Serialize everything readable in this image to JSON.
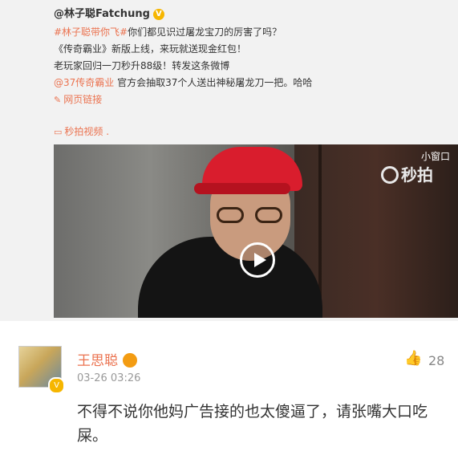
{
  "post": {
    "author": "@林子聪Fatchung",
    "verified_icon": "verified-badge-icon",
    "line1_tag": "#林子聪带你飞#",
    "line1_text": "你们都见识过屠龙宝刀的厉害了吗？",
    "line2": "《传奇霸业》新版上线，来玩就送现金红包！",
    "line3": "老玩家回归一刀秒升88级！转发这条微博",
    "line4_mention": "@37传奇霸业",
    "line4_text": " 官方会抽取37个人送出神秘屠龙刀一把。哈哈",
    "web_link": "网页链接",
    "video_link": "秒拍视频 ."
  },
  "video": {
    "mini_window": "小窗口",
    "brand": "秒拍",
    "play_icon": "play-icon"
  },
  "comment": {
    "name": "王思聪",
    "time": "03-26 03:26",
    "likes": "28",
    "text": "不得不说你他妈广告接的也太傻逼了，请张嘴大口吃屎。",
    "like_icon": "thumbs-up-icon"
  },
  "colors": {
    "accent": "#eb7350",
    "badge": "#f6b600"
  }
}
